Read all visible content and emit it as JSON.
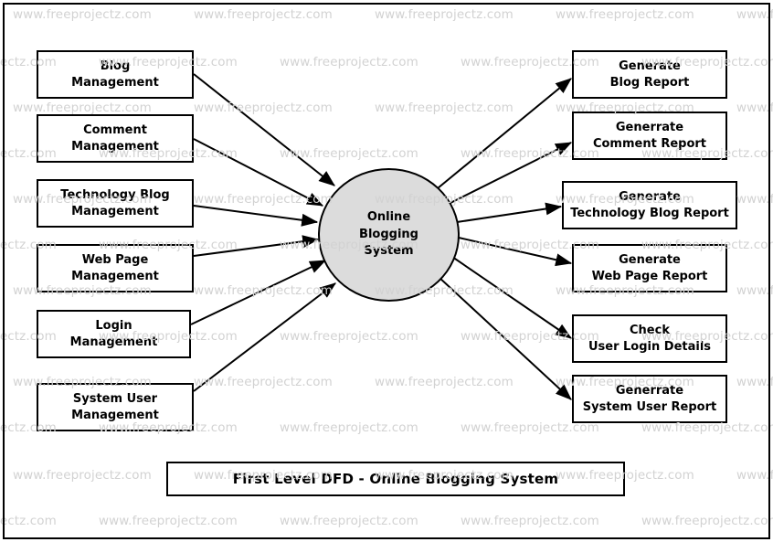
{
  "diagram": {
    "title": "First Level DFD - Online Blogging System",
    "type": "data-flow-diagram",
    "level": "First Level DFD",
    "process": {
      "name": "Online\nBlogging\nSystem",
      "fill_color": "#dcdcdc",
      "stroke_color": "#000000"
    },
    "inputs": [
      {
        "label": "Blog\nManagement"
      },
      {
        "label": "Comment\nManagement"
      },
      {
        "label": "Technology Blog\nManagement"
      },
      {
        "label": "Web Page\nManagement"
      },
      {
        "label": "Login\nManagement"
      },
      {
        "label": "System User\nManagement"
      }
    ],
    "outputs": [
      {
        "label": "Generate\nBlog Report"
      },
      {
        "label": "Generrate\nComment Report"
      },
      {
        "label": "Generate\nTechnology Blog Report"
      },
      {
        "label": "Generate\nWeb Page Report"
      },
      {
        "label": "Check\nUser Login Details"
      },
      {
        "label": "Generrate\nSystem User Report"
      }
    ]
  },
  "watermark": {
    "text": "www.freeprojectz.com",
    "color": "#d2d2d2"
  }
}
